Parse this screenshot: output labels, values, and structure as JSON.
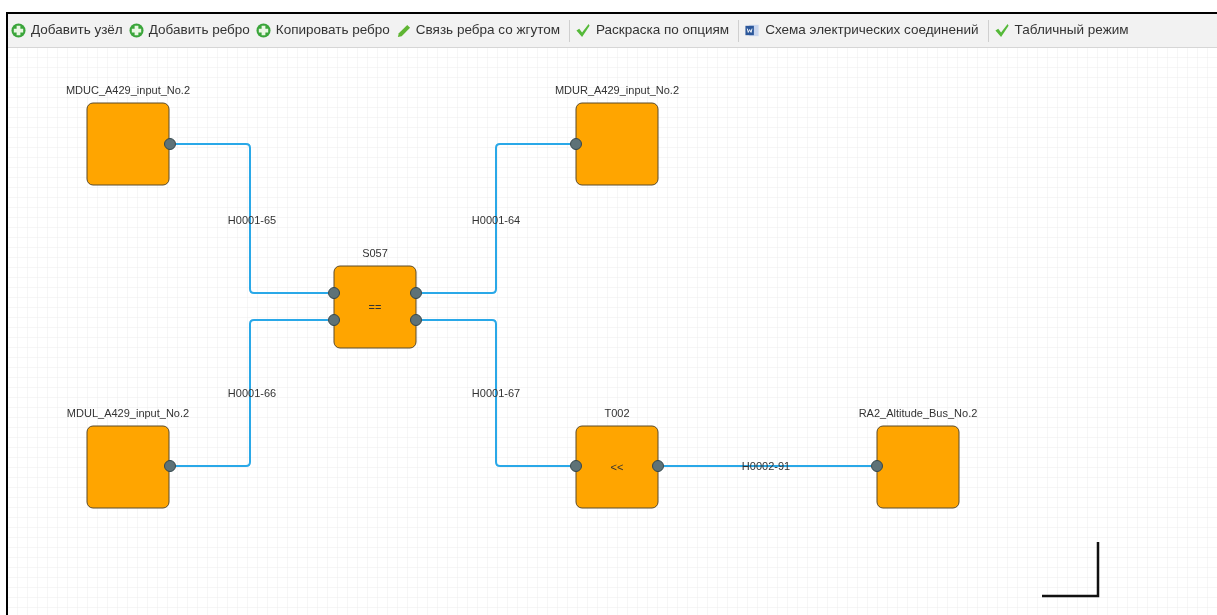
{
  "toolbar": {
    "groups": [
      [
        {
          "label": "Добавить узёл",
          "kind": "add"
        },
        {
          "label": "Добавить ребро",
          "kind": "add"
        },
        {
          "label": "Копировать ребро",
          "kind": "add"
        },
        {
          "label": "Связь ребра со жгутом",
          "kind": "edit"
        }
      ],
      [
        {
          "label": "Раскраска по опциям",
          "kind": "check"
        }
      ],
      [
        {
          "label": "Схема электрических соединений",
          "kind": "doc"
        }
      ],
      [
        {
          "label": "Табличный режим",
          "kind": "check"
        }
      ]
    ]
  },
  "diagram": {
    "nodes": [
      {
        "label": "MDUC_A429_input_No.2"
      },
      {
        "label": "MDUR_A429_input_No.2"
      },
      {
        "label": "S057",
        "symbol": "=="
      },
      {
        "label": "MDUL_A429_input_No.2"
      },
      {
        "label": "T002",
        "symbol": "<<"
      },
      {
        "label": "RA2_Altitude_Bus_No.2"
      }
    ],
    "edges": [
      {
        "label": "H0001-65"
      },
      {
        "label": "H0001-64"
      },
      {
        "label": "H0001-66"
      },
      {
        "label": "H0001-67"
      },
      {
        "label": "H0002-91"
      }
    ]
  }
}
